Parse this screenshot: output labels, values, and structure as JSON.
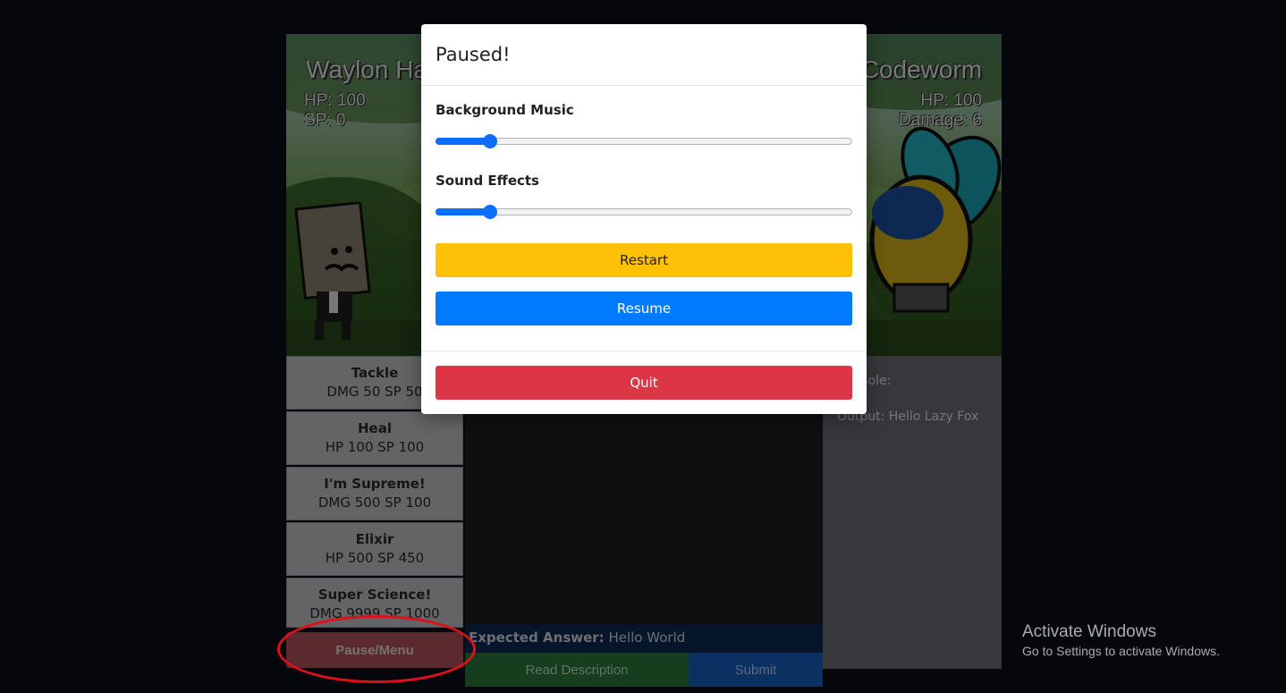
{
  "hero": {
    "name": "Waylon Hatchet",
    "hp": "HP: 100",
    "sp": "SP: 0"
  },
  "enemy": {
    "name": "Codeworm",
    "hp": "HP: 100",
    "damage": "Damage: 6"
  },
  "moves": [
    {
      "name": "Tackle",
      "stats": "DMG 50 SP 50"
    },
    {
      "name": "Heal",
      "stats": "HP 100 SP 100"
    },
    {
      "name": "I'm Supreme!",
      "stats": "DMG 500 SP 100"
    },
    {
      "name": "Elixir",
      "stats": "HP 500 SP 450"
    },
    {
      "name": "Super Science!",
      "stats": "DMG 9999 SP 1000"
    }
  ],
  "pause_button": "Pause/Menu",
  "expected": {
    "label": "Expected Answer:",
    "value": "Hello World"
  },
  "buttons": {
    "read_description": "Read Description",
    "submit": "Submit"
  },
  "console": {
    "label": "Console:",
    "output": "Output: Hello Lazy Fox"
  },
  "modal": {
    "title": "Paused!",
    "music_label": "Background Music",
    "music_level": 0.13,
    "effects_label": "Sound Effects",
    "effects_level": 0.13,
    "restart": "Restart",
    "resume": "Resume",
    "quit": "Quit"
  },
  "watermark": {
    "title": "Activate Windows",
    "subtitle": "Go to Settings to activate Windows."
  },
  "colors": {
    "accent": "#007bff",
    "restart": "#ffc107",
    "quit": "#dc3545"
  }
}
